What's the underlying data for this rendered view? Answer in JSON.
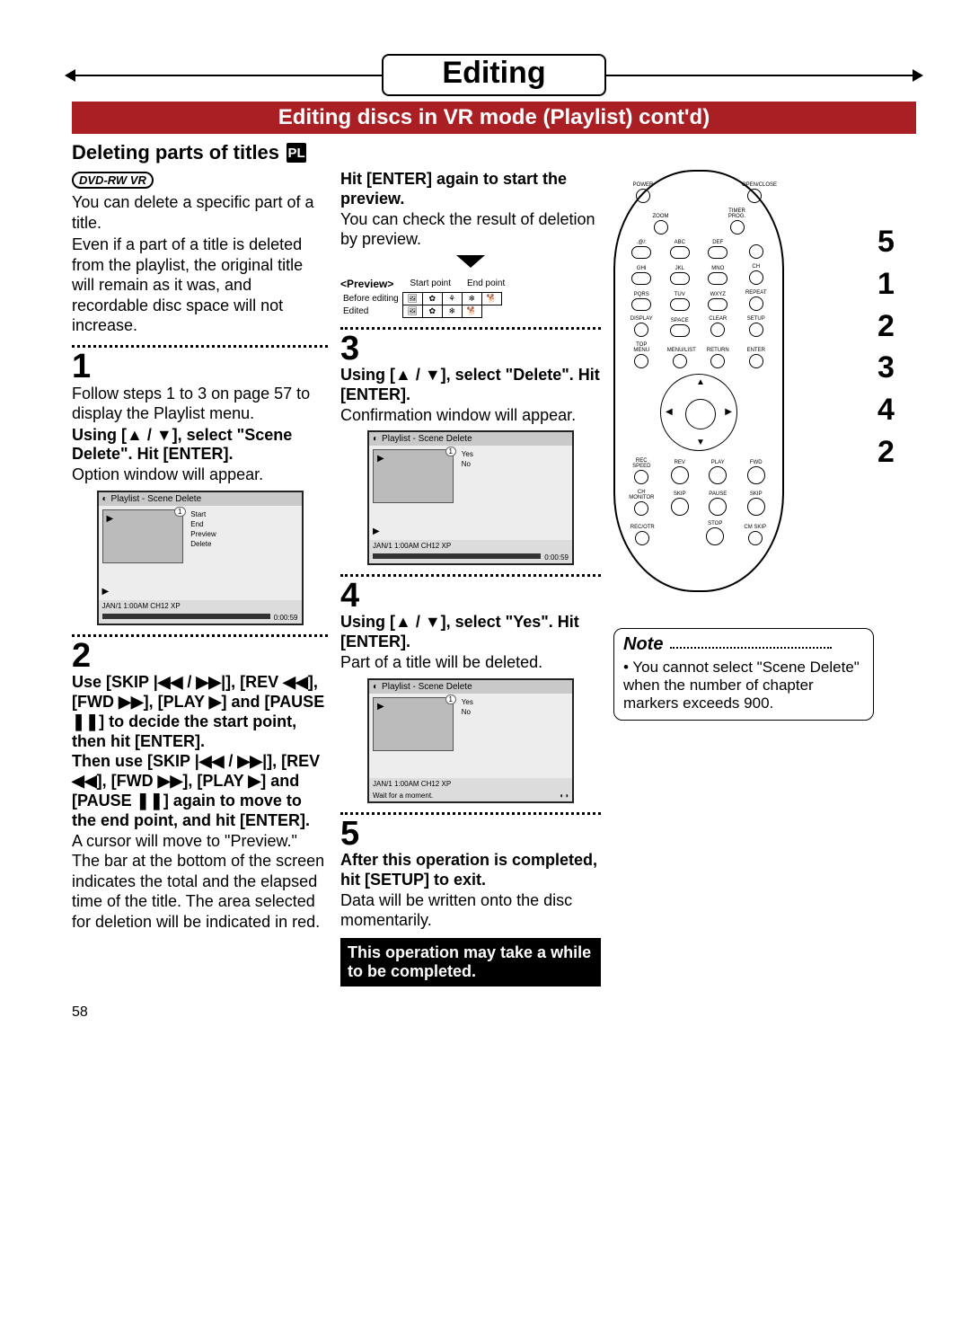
{
  "page_number": "58",
  "chapter_title": "Editing",
  "section_banner": "Editing discs in VR mode (Playlist) cont'd)",
  "subsection": {
    "title": "Deleting parts of titles",
    "icon_label": "PL"
  },
  "badge": "DVD-RW VR",
  "left": {
    "intro1": "You can delete a specific part of a title.",
    "intro2": "Even if a part of a title is deleted from the playlist, the original title will remain as it was, and recordable disc space will not increase.",
    "step1_num": "1",
    "step1_a": "Follow steps 1 to 3 on page 57 to display the Playlist menu.",
    "step1_b": "Using [▲ / ▼], select \"Scene Delete\". Hit [ENTER].",
    "step1_c": "Option window will appear.",
    "screen1": {
      "title": "Playlist - Scene Delete",
      "thumb_idx": "1",
      "options": [
        "Start",
        "End",
        "Preview",
        "Delete"
      ],
      "status": "JAN/1 1:00AM CH12 XP",
      "time": "0:00:59"
    },
    "step2_num": "2",
    "step2_a": "Use [SKIP |◀◀ / ▶▶|], [REV ◀◀], [FWD ▶▶], [PLAY ▶] and [PAUSE ❚❚] to decide the start point, then hit [ENTER].",
    "step2_b": "Then use [SKIP |◀◀ / ▶▶|], [REV ◀◀], [FWD ▶▶], [PLAY ▶] and [PAUSE ❚❚] again to move to the end point, and hit [ENTER].",
    "step2_c": "A cursor will move to \"Preview.\" The bar at the bottom of the screen indicates the total and the elapsed time of the title. The area selected for deletion will be indicated in red."
  },
  "mid": {
    "preview_h1": "Hit [ENTER] again to start the preview.",
    "preview_h2": "You can check the result of deletion by preview.",
    "preview_label": "<Preview>",
    "start_label": "Start point",
    "end_label": "End point",
    "row_before": "Before editing",
    "row_edited": "Edited",
    "step3_num": "3",
    "step3_a": "Using [▲ / ▼], select \"Delete\". Hit [ENTER].",
    "step3_b": "Confirmation window will appear.",
    "screen3": {
      "title": "Playlist - Scene Delete",
      "thumb_idx": "1",
      "options": [
        "Yes",
        "No"
      ],
      "status": "JAN/1 1:00AM CH12 XP",
      "time": "0:00:59"
    },
    "step4_num": "4",
    "step4_a": "Using [▲ / ▼], select \"Yes\". Hit [ENTER].",
    "step4_b": "Part of a title will be deleted.",
    "screen4": {
      "title": "Playlist - Scene Delete",
      "thumb_idx": "1",
      "options": [
        "Yes",
        "No"
      ],
      "status": "JAN/1 1:00AM CH12 XP",
      "wait": "Wait for a moment."
    },
    "step5_num": "5",
    "step5_a": "After this operation is completed, hit [SETUP] to exit.",
    "step5_b": "Data will be written onto the disc momentarily.",
    "warn": "This operation may take a while to be completed."
  },
  "remote": {
    "labels_r1": [
      "POWER",
      "",
      "",
      "OPEN/CLOSE"
    ],
    "labels_r2": [
      "",
      "ZOOM",
      "TIMER PROG.",
      ""
    ],
    "labels_num": [
      ".@/:",
      "ABC",
      "DEF",
      "",
      "GHI",
      "JKL",
      "MNO",
      "CH",
      "PQRS",
      "TUV",
      "WXYZ",
      "REPEAT",
      "DISPLAY",
      "SPACE",
      "CLEAR",
      "SETUP"
    ],
    "labels_menu": [
      "TOP MENU",
      "MENU/LIST",
      "RETURN",
      "ENTER"
    ],
    "labels_play": [
      "REC SPEED",
      "REV",
      "PLAY",
      "FWD",
      "CH MONITOR",
      "SKIP",
      "PAUSE",
      "SKIP",
      "REC/OTR",
      "",
      "STOP",
      "CM SKIP"
    ]
  },
  "side_numbers": [
    "5",
    "1",
    "2",
    "3",
    "4",
    "2"
  ],
  "note": {
    "title": "Note",
    "text": "• You cannot select \"Scene Delete\" when the number of chapter markers exceeds 900."
  }
}
